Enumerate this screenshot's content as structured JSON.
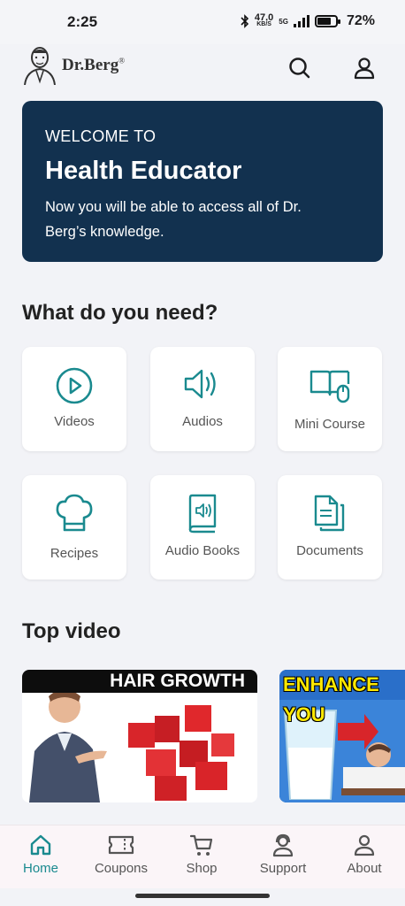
{
  "status_bar": {
    "time": "2:25",
    "net_speed_value": "47.0",
    "net_speed_unit": "KB/S",
    "network_type": "5G",
    "battery": "72%"
  },
  "header": {
    "logo_text": "Dr.Berg",
    "logo_mark": "®"
  },
  "welcome": {
    "kicker": "WELCOME TO",
    "title": "Health Educator",
    "description": "Now you will be able to access all of Dr. Berg’s knowledge."
  },
  "needs": {
    "title": "What do you need?",
    "items": [
      {
        "label": "Videos",
        "icon": "play-circle-icon"
      },
      {
        "label": "Audios",
        "icon": "speaker-icon"
      },
      {
        "label": "Mini Course",
        "icon": "book-mouse-icon"
      },
      {
        "label": "Recipes",
        "icon": "chef-hat-icon"
      },
      {
        "label": "Audio Books",
        "icon": "audio-book-icon"
      },
      {
        "label": "Documents",
        "icon": "documents-icon"
      }
    ]
  },
  "top_video": {
    "title": "Top video",
    "videos": [
      {
        "thumb_text": "HAIR GROWTH"
      },
      {
        "thumb_text": "ENHANCE YOU"
      }
    ]
  },
  "bottom_nav": {
    "items": [
      {
        "label": "Home",
        "icon": "home-icon",
        "active": true
      },
      {
        "label": "Coupons",
        "icon": "ticket-icon",
        "active": false
      },
      {
        "label": "Shop",
        "icon": "cart-icon",
        "active": false
      },
      {
        "label": "Support",
        "icon": "headset-icon",
        "active": false
      },
      {
        "label": "About",
        "icon": "person-icon",
        "active": false
      }
    ]
  },
  "colors": {
    "accent": "#1a8a8f",
    "banner": "#12314f",
    "background": "#f2f3f7"
  }
}
